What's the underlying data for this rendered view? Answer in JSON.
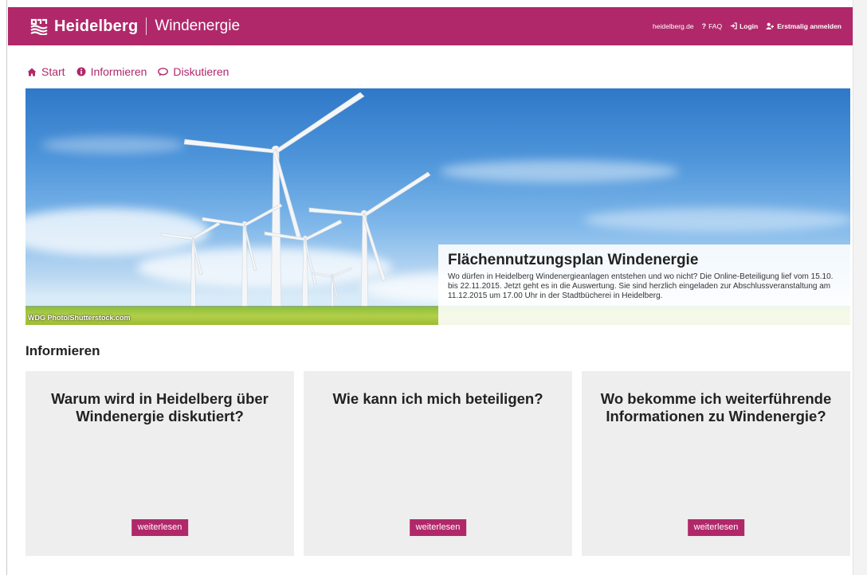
{
  "header": {
    "brand": "Heidelberg",
    "subtitle": "Windenergie",
    "logo_icon": "heidelberg-logo",
    "nav": [
      {
        "label": "heidelberg.de",
        "icon": ""
      },
      {
        "label": "FAQ",
        "icon": "question-icon"
      },
      {
        "label": "Login",
        "icon": "login-icon"
      },
      {
        "label": "Erstmalig anmelden",
        "icon": "user-add-icon"
      }
    ]
  },
  "subnav": [
    {
      "label": "Start",
      "icon": "home-icon"
    },
    {
      "label": "Informieren",
      "icon": "info-circle-icon"
    },
    {
      "label": "Diskutieren",
      "icon": "comment-icon"
    }
  ],
  "hero": {
    "credit": "WDG Photo/Shutterstock.com",
    "title": "Flächennutzungsplan Windenergie",
    "text": "Wo dürfen in Heidelberg Windenergieanlagen entstehen und wo nicht? Die Online-Beteiligung lief vom 15.10. bis 22.11.2015. Jetzt geht es in die Auswertung. Sie sind herzlich eingeladen zur Abschlussveranstaltung am 11.12.2015 um 17.00 Uhr in der Stadtbücherei in Heidelberg."
  },
  "section": {
    "title": "Informieren"
  },
  "cards": [
    {
      "title": "Warum wird in Heidelberg über Windenergie diskutiert?",
      "button": "weiterlesen"
    },
    {
      "title": "Wie kann ich mich beteiligen?",
      "button": "weiterlesen"
    },
    {
      "title": "Wo bekomme ich weiterführende Informationen zu Windenergie?",
      "button": "weiterlesen"
    }
  ],
  "colors": {
    "brand": "#b0286a",
    "card_bg": "#efeeee"
  }
}
